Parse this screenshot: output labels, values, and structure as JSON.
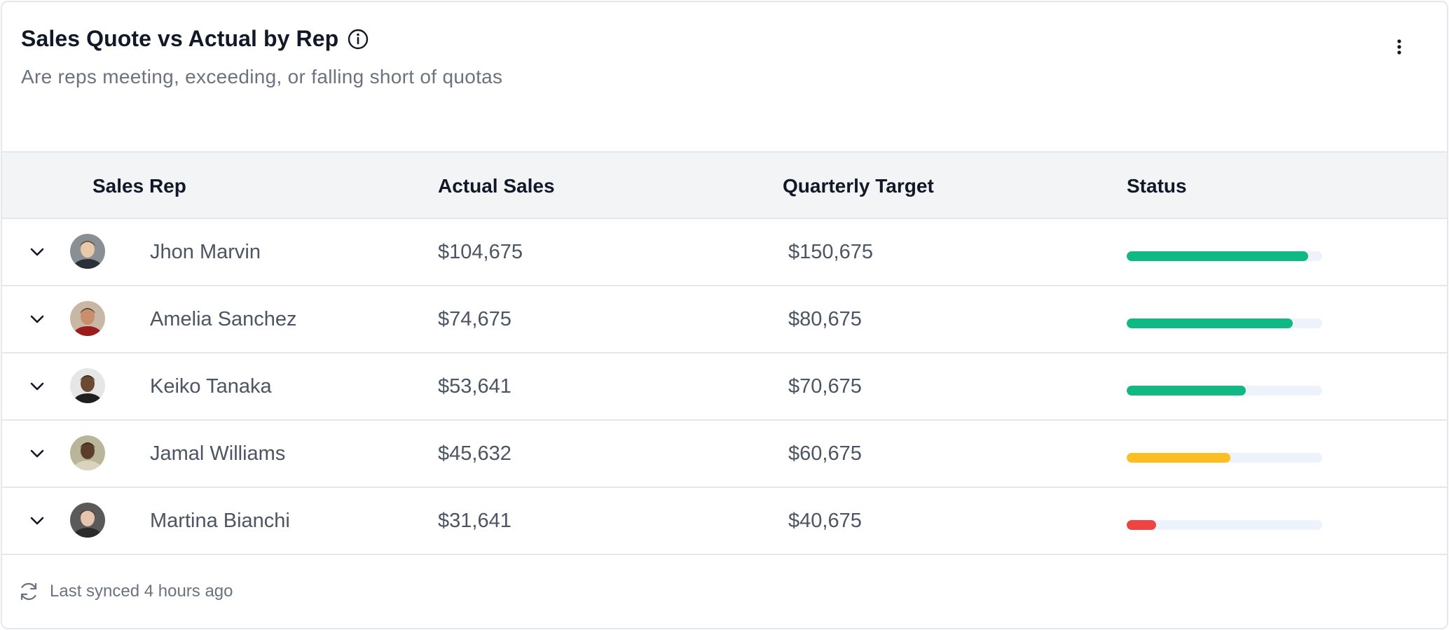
{
  "header": {
    "title": "Sales Quote vs Actual by Rep",
    "subtitle": "Are reps meeting, exceeding, or falling short of quotas"
  },
  "icons": {
    "info": "info-icon",
    "menu": "more-vertical-icon",
    "expand": "chevron-down-icon",
    "sync": "refresh-icon"
  },
  "table": {
    "columns": {
      "rep": "Sales Rep",
      "actual": "Actual Sales",
      "target": "Quarterly Target",
      "status": "Status"
    },
    "rows": [
      {
        "name": "Jhon Marvin",
        "actual": "$104,675",
        "target": "$150,675",
        "progress": 0.93,
        "status_color": "#10b981",
        "avatar_bg": "#8a8f94",
        "avatar_fg": "#e8c9a8",
        "avatar_shirt": "#2a2f3a"
      },
      {
        "name": "Amelia Sanchez",
        "actual": "$74,675",
        "target": "$80,675",
        "progress": 0.85,
        "status_color": "#10b981",
        "avatar_bg": "#c9b7a6",
        "avatar_fg": "#c98e6b",
        "avatar_shirt": "#9b1c1c"
      },
      {
        "name": "Keiko Tanaka",
        "actual": "$53,641",
        "target": "$70,675",
        "progress": 0.61,
        "status_color": "#10b981",
        "avatar_bg": "#e6e6e6",
        "avatar_fg": "#6b4a33",
        "avatar_shirt": "#1f1f1f"
      },
      {
        "name": "Jamal Williams",
        "actual": "$45,632",
        "target": "$60,675",
        "progress": 0.53,
        "status_color": "#fbbf24",
        "avatar_bg": "#b9b59a",
        "avatar_fg": "#5a3e2b",
        "avatar_shirt": "#d9d3c0"
      },
      {
        "name": "Martina Bianchi",
        "actual": "$31,641",
        "target": "$40,675",
        "progress": 0.15,
        "status_color": "#ef4444",
        "avatar_bg": "#5a5a5a",
        "avatar_fg": "#e6c4ad",
        "avatar_shirt": "#2b2b2b"
      }
    ]
  },
  "footer": {
    "sync_text": "Last synced 4 hours ago"
  }
}
